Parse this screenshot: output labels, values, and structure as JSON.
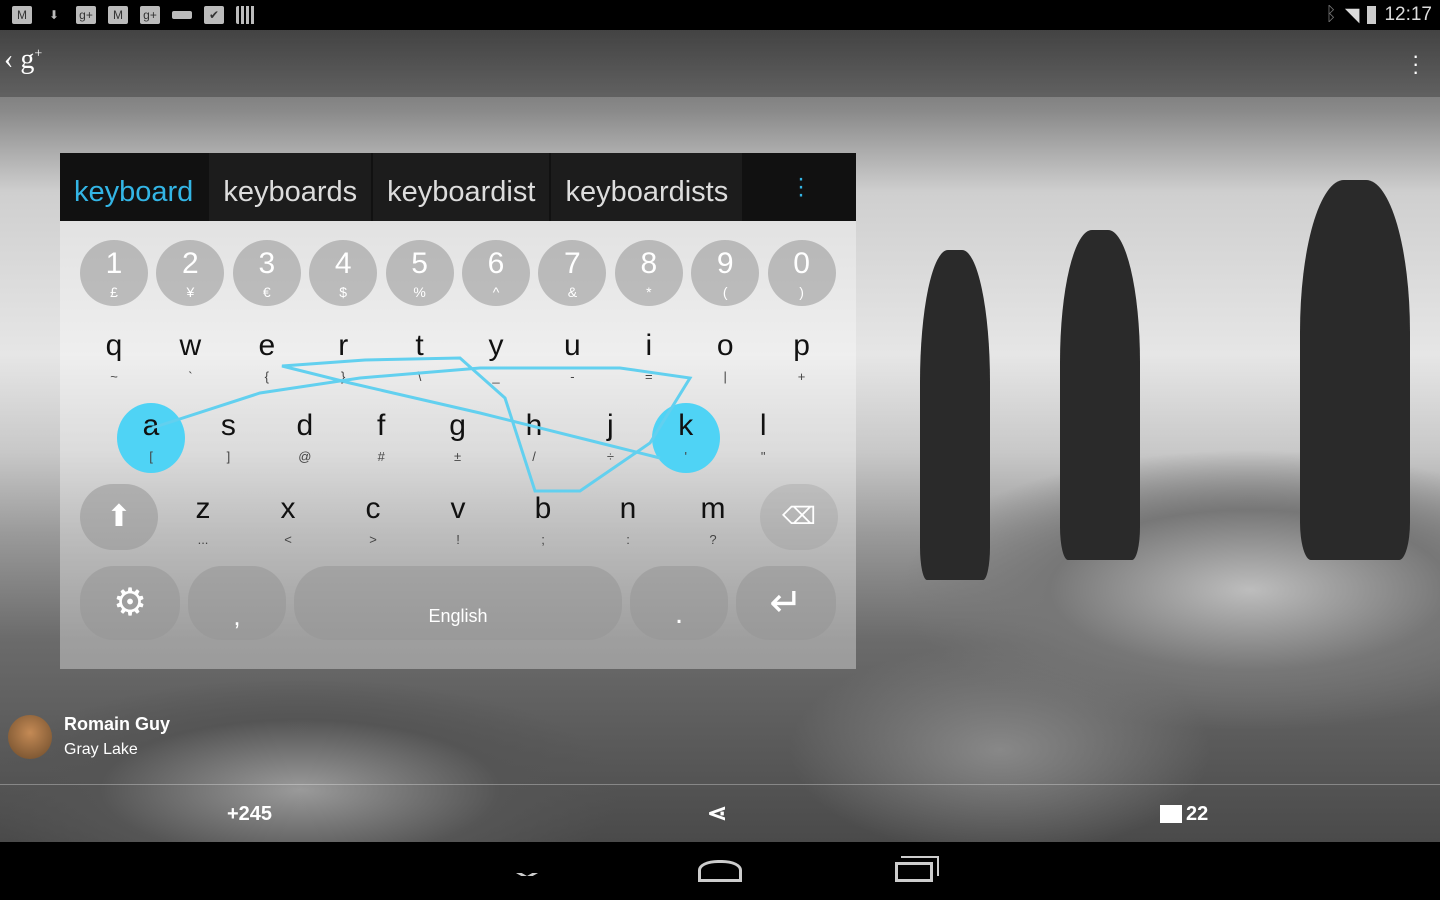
{
  "status_bar": {
    "time": "12:17",
    "left_icons": [
      "gmail-icon",
      "download-icon",
      "google-plus-icon",
      "gmail-icon",
      "google-plus-icon",
      "keyboard-icon",
      "play-store-icon",
      "barcode-icon"
    ],
    "right_icons": [
      "bluetooth-icon",
      "wifi-icon",
      "battery-icon"
    ]
  },
  "action_bar": {
    "app": "google-plus-icon",
    "overflow": "overflow-menu-icon"
  },
  "keyboard": {
    "suggestions": [
      "keyboard",
      "keyboards",
      "keyboardist",
      "keyboardists"
    ],
    "number_row": [
      [
        "1",
        "£"
      ],
      [
        "2",
        "¥"
      ],
      [
        "3",
        "€"
      ],
      [
        "4",
        "$"
      ],
      [
        "5",
        "%"
      ],
      [
        "6",
        "^"
      ],
      [
        "7",
        "&"
      ],
      [
        "8",
        "*"
      ],
      [
        "9",
        "("
      ],
      [
        "0",
        ")"
      ]
    ],
    "row1": [
      [
        "q",
        "~"
      ],
      [
        "w",
        "`"
      ],
      [
        "e",
        "{"
      ],
      [
        "r",
        "}"
      ],
      [
        "t",
        "\\"
      ],
      [
        "y",
        "_"
      ],
      [
        "u",
        "-"
      ],
      [
        "i",
        "="
      ],
      [
        "o",
        "|"
      ],
      [
        "p",
        "+"
      ]
    ],
    "row2": [
      [
        "a",
        "["
      ],
      [
        "s",
        "]"
      ],
      [
        "d",
        "@"
      ],
      [
        "f",
        "#"
      ],
      [
        "g",
        "±"
      ],
      [
        "h",
        "/"
      ],
      [
        "j",
        "÷"
      ],
      [
        "k",
        "'"
      ],
      [
        "l",
        "\""
      ]
    ],
    "row3": [
      [
        "z",
        "..."
      ],
      [
        "x",
        "<"
      ],
      [
        "c",
        ">"
      ],
      [
        "v",
        "!"
      ],
      [
        "b",
        ";"
      ],
      [
        "n",
        ":"
      ],
      [
        "m",
        "?"
      ]
    ],
    "comma": ",",
    "space": "English",
    "period": ".",
    "highlighted": [
      "a",
      "k"
    ],
    "accent": "#33b5e5"
  },
  "photo": {
    "author": "Romain Guy",
    "title": "Gray Lake",
    "plus_count": "+245",
    "comments": "22"
  }
}
